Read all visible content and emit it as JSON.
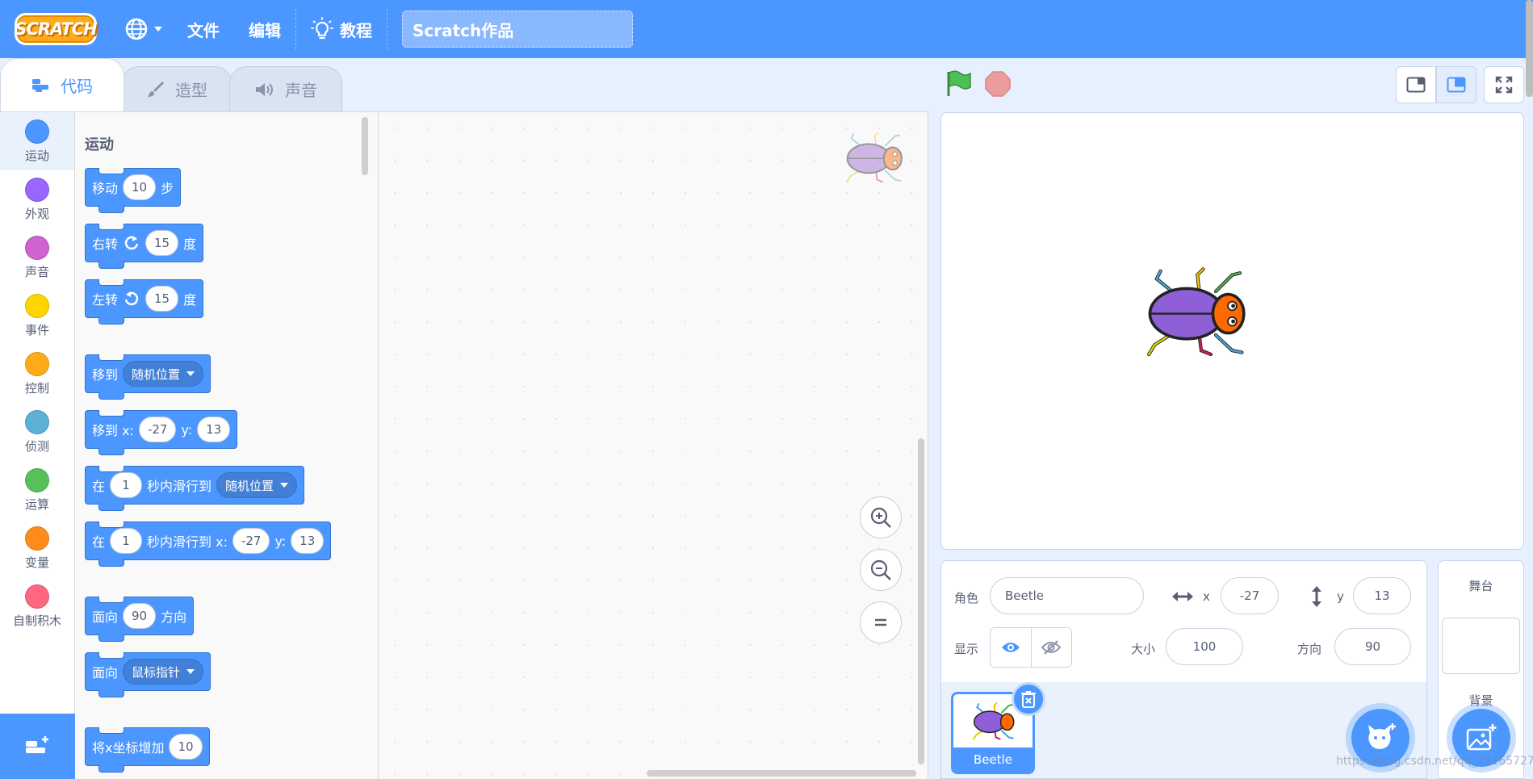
{
  "menubar": {
    "logo": "SCRATCH",
    "language_icon": "globe-icon",
    "file": "文件",
    "edit": "编辑",
    "tutorial": "教程",
    "project_title": "Scratch作品"
  },
  "tabs": [
    {
      "label": "代码",
      "icon": "code-icon"
    },
    {
      "label": "造型",
      "icon": "brush-icon"
    },
    {
      "label": "声音",
      "icon": "speaker-icon"
    }
  ],
  "categories": [
    {
      "label": "运动",
      "color": "#4c97ff"
    },
    {
      "label": "外观",
      "color": "#9966ff"
    },
    {
      "label": "声音",
      "color": "#cf63cf"
    },
    {
      "label": "事件",
      "color": "#ffd500"
    },
    {
      "label": "控制",
      "color": "#ffab19"
    },
    {
      "label": "侦测",
      "color": "#5cb1d6"
    },
    {
      "label": "运算",
      "color": "#59c059"
    },
    {
      "label": "变量",
      "color": "#ff8c1a"
    },
    {
      "label": "自制积木",
      "color": "#ff6680"
    }
  ],
  "palette": {
    "title": "运动",
    "blocks": {
      "move": {
        "a": "移动",
        "v": "10",
        "b": "步"
      },
      "turn_right": {
        "a": "右转",
        "v": "15",
        "b": "度"
      },
      "turn_left": {
        "a": "左转",
        "v": "15",
        "b": "度"
      },
      "goto": {
        "a": "移到",
        "dd": "随机位置"
      },
      "goto_xy": {
        "a": "移到 x:",
        "x": "-27",
        "y_label": "y:",
        "y": "13"
      },
      "glide": {
        "a": "在",
        "v": "1",
        "b": "秒内滑行到",
        "dd": "随机位置"
      },
      "glide_xy": {
        "a": "在",
        "v": "1",
        "b": "秒内滑行到 x:",
        "x": "-27",
        "y_label": "y:",
        "y": "13"
      },
      "point_dir": {
        "a": "面向",
        "v": "90",
        "b": "方向"
      },
      "point_towards": {
        "a": "面向",
        "dd": "鼠标指针"
      },
      "change_x": {
        "a": "将x坐标增加",
        "v": "10"
      }
    }
  },
  "sprite_info": {
    "sprite_label": "角色",
    "sprite_name": "Beetle",
    "x_label": "x",
    "x": "-27",
    "y_label": "y",
    "y": "13",
    "show_label": "显示",
    "size_label": "大小",
    "size": "100",
    "direction_label": "方向",
    "direction": "90"
  },
  "sprites": [
    {
      "name": "Beetle"
    }
  ],
  "stage_selector": {
    "title": "舞台",
    "backdrops_label": "背景"
  },
  "watermark": "https://blog.csdn.net/qq_29165727",
  "colors": {
    "accent": "#4c97ff",
    "motion": "#4c97ff",
    "menubar": "#4c97ff"
  }
}
